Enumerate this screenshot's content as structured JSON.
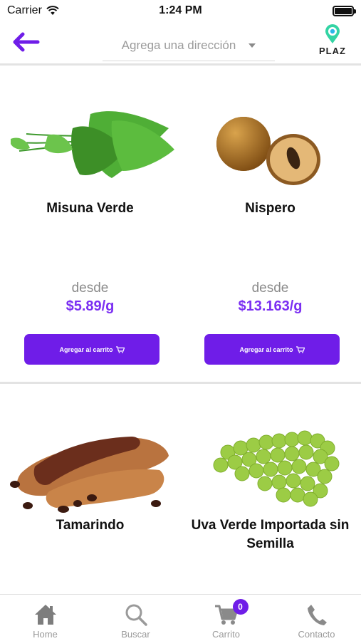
{
  "status_bar": {
    "carrier": "Carrier",
    "time": "1:24 PM"
  },
  "header": {
    "address_placeholder": "Agrega una dirección",
    "logo_text": "PLAZ"
  },
  "products": [
    {
      "name": "Misuna Verde",
      "price_from": "desde",
      "price": "$5.89/g",
      "button_label": "Agregar al carrito"
    },
    {
      "name": "Nispero",
      "price_from": "desde",
      "price": "$13.163/g",
      "button_label": "Agregar al carrito"
    },
    {
      "name": "Tamarindo"
    },
    {
      "name": "Uva Verde Importada sin Semilla"
    }
  ],
  "tab_bar": {
    "items": [
      {
        "label": "Home",
        "icon": "home-icon"
      },
      {
        "label": "Buscar",
        "icon": "search-icon"
      },
      {
        "label": "Carrito",
        "icon": "cart-icon",
        "badge": "0"
      },
      {
        "label": "Contacto",
        "icon": "phone-icon"
      }
    ]
  },
  "colors": {
    "accent": "#6f1de8",
    "price": "#7b2ff2",
    "back_arrow": "#6f1de8"
  }
}
